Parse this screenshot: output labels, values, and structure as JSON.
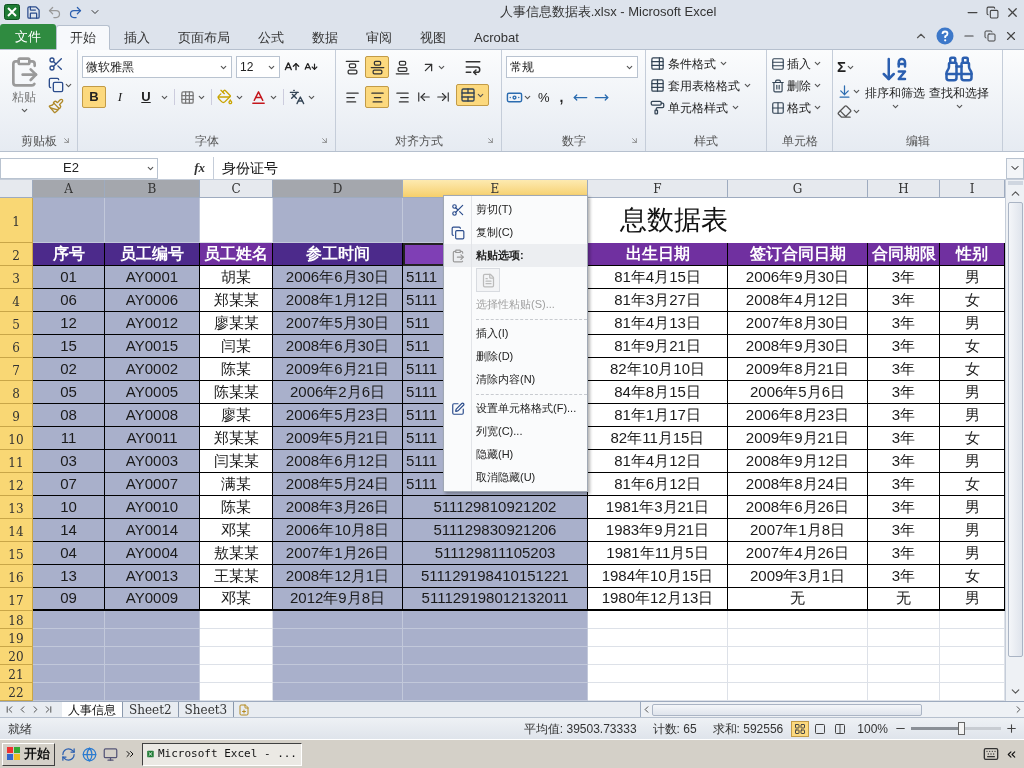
{
  "window": {
    "title": "人事信息数据表.xlsx - Microsoft Excel"
  },
  "ribbon_tabs": [
    {
      "label": "文件",
      "kind": "file",
      "selected": false
    },
    {
      "label": "开始",
      "kind": "tab",
      "selected": true
    },
    {
      "label": "插入",
      "kind": "tab",
      "selected": false
    },
    {
      "label": "页面布局",
      "kind": "tab",
      "selected": false
    },
    {
      "label": "公式",
      "kind": "tab",
      "selected": false
    },
    {
      "label": "数据",
      "kind": "tab",
      "selected": false
    },
    {
      "label": "审阅",
      "kind": "tab",
      "selected": false
    },
    {
      "label": "视图",
      "kind": "tab",
      "selected": false
    },
    {
      "label": "Acrobat",
      "kind": "tab",
      "selected": false
    }
  ],
  "clipboard": {
    "paste": "粘贴",
    "group": "剪贴板"
  },
  "font": {
    "name": "微软雅黑",
    "size": "12",
    "bold": {
      "label": "B",
      "selected": true
    },
    "italic": {
      "label": "I",
      "selected": false
    },
    "underline": {
      "label": "U",
      "selected": false
    },
    "group": "字体"
  },
  "alignment": {
    "vertical": [
      {
        "selected": false
      },
      {
        "selected": true
      },
      {
        "selected": false
      }
    ],
    "horizontal": [
      {
        "selected": false
      },
      {
        "selected": true
      },
      {
        "selected": false
      }
    ],
    "merge": {
      "selected": true
    },
    "group": "对齐方式"
  },
  "number": {
    "format": "常规",
    "percent": "%",
    "comma": ",",
    "group": "数字"
  },
  "styles": {
    "items": [
      "条件格式",
      "套用表格格式",
      "单元格样式"
    ],
    "group": "样式"
  },
  "cells": {
    "items": [
      "插入",
      "删除",
      "格式"
    ],
    "group": "单元格"
  },
  "editing": {
    "sigma": "Σ",
    "sort": "排序和筛选",
    "find": "查找和选择",
    "group": "编辑"
  },
  "formula_bar": {
    "name_box": "E2",
    "fx": "fx",
    "value": "身份证号"
  },
  "columns": [
    {
      "letter": "A",
      "selected": true,
      "active": false,
      "header": "序号"
    },
    {
      "letter": "B",
      "selected": true,
      "active": false,
      "header": "员工编号"
    },
    {
      "letter": "C",
      "selected": false,
      "active": false,
      "header": "员工姓名"
    },
    {
      "letter": "D",
      "selected": true,
      "active": false,
      "header": "参工时间"
    },
    {
      "letter": "E",
      "selected": true,
      "active": true
    },
    {
      "letter": "F",
      "selected": false,
      "active": false,
      "header": "出生日期"
    },
    {
      "letter": "G",
      "selected": false,
      "active": false,
      "header": "签订合同日期"
    },
    {
      "letter": "H",
      "selected": false,
      "active": false,
      "header": "合同期限"
    },
    {
      "letter": "I",
      "selected": false,
      "active": false,
      "header": "性别"
    }
  ],
  "rows": [
    {
      "label": "1",
      "selected": true
    },
    {
      "label": "2",
      "selected": true
    },
    {
      "label": "3",
      "selected": true
    },
    {
      "label": "4",
      "selected": true
    },
    {
      "label": "5",
      "selected": true
    },
    {
      "label": "6",
      "selected": true
    },
    {
      "label": "7",
      "selected": true
    },
    {
      "label": "8",
      "selected": true
    },
    {
      "label": "9",
      "selected": true
    },
    {
      "label": "10",
      "selected": true
    },
    {
      "label": "11",
      "selected": true
    },
    {
      "label": "12",
      "selected": true
    },
    {
      "label": "13",
      "selected": true
    },
    {
      "label": "14",
      "selected": true
    },
    {
      "label": "15",
      "selected": true
    },
    {
      "label": "16",
      "selected": true
    },
    {
      "label": "17",
      "selected": true
    },
    {
      "label": "18",
      "selected": true
    },
    {
      "label": "19",
      "selected": true
    },
    {
      "label": "20",
      "selected": true
    },
    {
      "label": "21",
      "selected": true
    },
    {
      "label": "22",
      "selected": true
    }
  ],
  "title_cell": "息数据表",
  "data_rows": [
    [
      "01",
      "AY0001",
      "胡某",
      "2006年6月30日",
      "5111",
      "81年4月15日",
      "2006年9月30日",
      "3年",
      "男"
    ],
    [
      "06",
      "AY0006",
      "郑某某",
      "2008年1月12日",
      "5111",
      "81年3月27日",
      "2008年4月12日",
      "3年",
      "女"
    ],
    [
      "12",
      "AY0012",
      "廖某某",
      "2007年5月30日",
      "511",
      "81年4月13日",
      "2007年8月30日",
      "3年",
      "男"
    ],
    [
      "15",
      "AY0015",
      "闫某",
      "2008年6月30日",
      "511",
      "81年9月21日",
      "2008年9月30日",
      "3年",
      "女"
    ],
    [
      "02",
      "AY0002",
      "陈某",
      "2009年6月21日",
      "5111",
      "82年10月10日",
      "2009年8月21日",
      "3年",
      "女"
    ],
    [
      "05",
      "AY0005",
      "陈某某",
      "2006年2月6日",
      "5111",
      "84年8月15日",
      "2006年5月6日",
      "3年",
      "男"
    ],
    [
      "08",
      "AY0008",
      "廖某",
      "2006年5月23日",
      "5111",
      "81年1月17日",
      "2006年8月23日",
      "3年",
      "男"
    ],
    [
      "11",
      "AY0011",
      "郑某某",
      "2009年5月21日",
      "5111",
      "82年11月15日",
      "2009年9月21日",
      "3年",
      "女"
    ],
    [
      "03",
      "AY0003",
      "闫某某",
      "2008年6月12日",
      "5111",
      "81年4月12日",
      "2008年9月12日",
      "3年",
      "男"
    ],
    [
      "07",
      "AY0007",
      "满某",
      "2008年5月24日",
      "5111",
      "81年6月12日",
      "2008年8月24日",
      "3年",
      "女"
    ],
    [
      "10",
      "AY0010",
      "陈某",
      "2008年3月26日",
      "511129810921202",
      "1981年3月21日",
      "2008年6月26日",
      "3年",
      "男"
    ],
    [
      "14",
      "AY0014",
      "邓某",
      "2006年10月8日",
      "511129830921206",
      "1983年9月21日",
      "2007年1月8日",
      "3年",
      "男"
    ],
    [
      "04",
      "AY0004",
      "敖某某",
      "2007年1月26日",
      "511129811105203",
      "1981年11月5日",
      "2007年4月26日",
      "3年",
      "男"
    ],
    [
      "13",
      "AY0013",
      "王某某",
      "2008年12月1日",
      "511129198410151221",
      "1984年10月15日",
      "2009年3月1日",
      "3年",
      "女"
    ],
    [
      "09",
      "AY0009",
      "邓某",
      "2012年9月8日",
      "511129198012132011",
      "1980年12月13日",
      "无",
      "无",
      "男"
    ]
  ],
  "context_menu": [
    {
      "kind": "item",
      "label": "剪切(T)",
      "disabled": false
    },
    {
      "kind": "item",
      "label": "复制(C)",
      "disabled": false
    },
    {
      "kind": "header",
      "label": "粘贴选项:"
    },
    {
      "kind": "paste_options",
      "disabled": true
    },
    {
      "kind": "item",
      "label": "选择性粘贴(S)...",
      "disabled": true
    },
    {
      "kind": "separator"
    },
    {
      "kind": "item",
      "label": "插入(I)",
      "disabled": false
    },
    {
      "kind": "item",
      "label": "删除(D)",
      "disabled": false
    },
    {
      "kind": "item",
      "label": "清除内容(N)",
      "disabled": false
    },
    {
      "kind": "separator"
    },
    {
      "kind": "item",
      "label": "设置单元格格式(F)...",
      "disabled": false
    },
    {
      "kind": "item",
      "label": "列宽(C)...",
      "disabled": false
    },
    {
      "kind": "item",
      "label": "隐藏(H)",
      "disabled": false
    },
    {
      "kind": "item",
      "label": "取消隐藏(U)",
      "disabled": false
    }
  ],
  "sheet_tabs": [
    {
      "label": "人事信息",
      "selected": true
    },
    {
      "label": "Sheet2",
      "selected": false
    },
    {
      "label": "Sheet3",
      "selected": false
    }
  ],
  "status_bar": {
    "mode": "就绪",
    "average": "平均值: 39503.73333",
    "count": "计数: 65",
    "sum": "求和: 592556",
    "zoom": "100%",
    "zoom_slider": {
      "level": 0.55
    },
    "views": [
      {
        "selected": true
      },
      {
        "selected": false
      },
      {
        "selected": false
      }
    ]
  },
  "taskbar": {
    "start": "开始",
    "tasks": [
      {
        "label": "Microsoft Excel - ...",
        "selected": true
      }
    ]
  }
}
